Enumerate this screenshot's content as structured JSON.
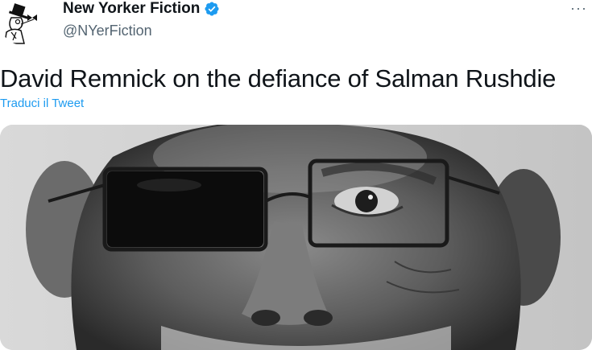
{
  "account": {
    "display_name": "New Yorker Fiction",
    "handle": "@NYerFiction",
    "verified": true,
    "avatar_icon": "newyorker-eustace-logo"
  },
  "tweet": {
    "text": "David Remnick on the defiance of Salman Rushdie",
    "translate_label": "Traduci il Tweet"
  },
  "menu": {
    "more_icon": "more-horizontal-icon",
    "more_glyph": "···"
  },
  "media": {
    "type": "photo",
    "palette": "black-and-white"
  },
  "colors": {
    "link": "#1d9bf0",
    "text": "#0f1419",
    "secondary": "#536471",
    "verified": "#1d9bf0"
  }
}
